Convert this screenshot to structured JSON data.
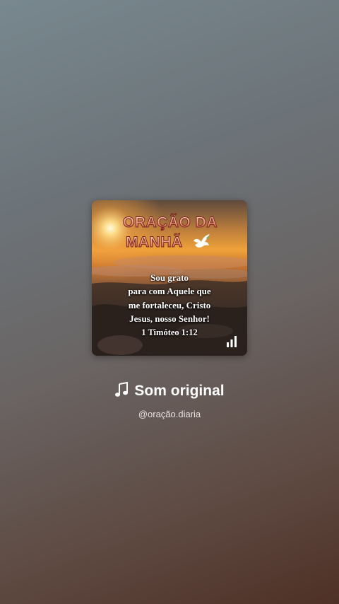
{
  "cover": {
    "title_line1": "ORAÇÃO DA",
    "title_line2": "MANHÃ",
    "verse_lines": [
      "Sou grato",
      "para com Aquele que",
      "me fortaleceu, Cristo",
      "Jesus, nosso Senhor!"
    ],
    "verse_reference": "1 Timóteo 1:12",
    "icons": [
      "dove-icon",
      "audio-bars-icon"
    ]
  },
  "sound": {
    "title": "Som original",
    "icon": "music-note-icon",
    "author_handle": "@oração.diaria"
  }
}
